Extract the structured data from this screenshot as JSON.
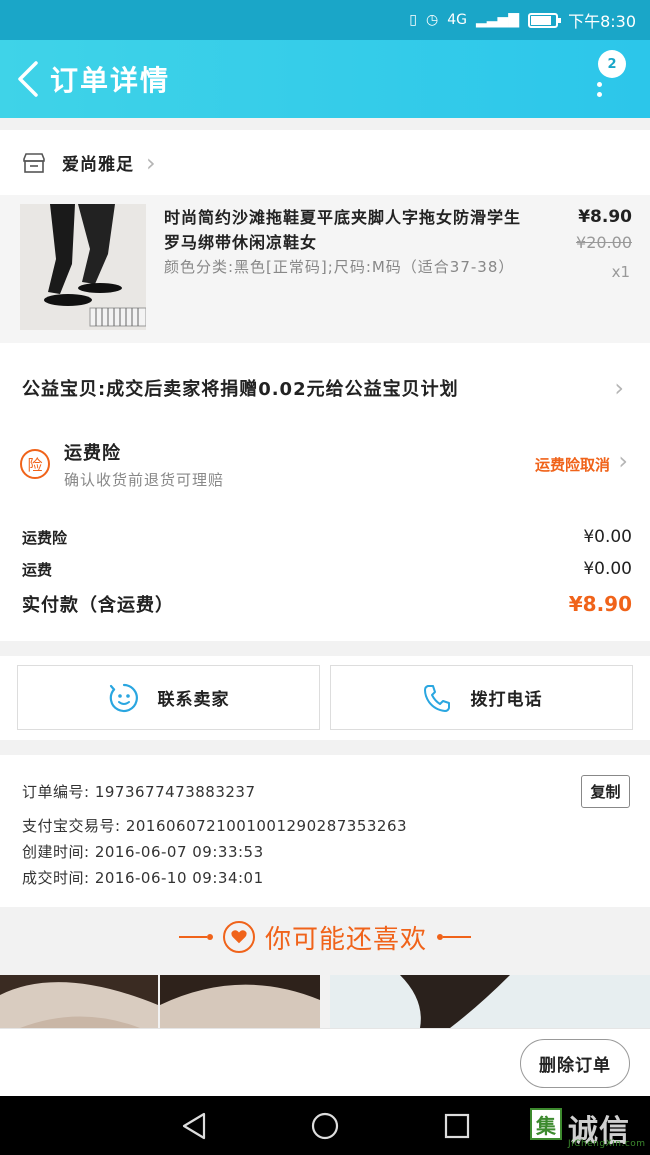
{
  "status_bar": {
    "signal": "4G",
    "time": "下午8:30",
    "battery_level": 0.85
  },
  "header": {
    "title": "订单详情",
    "badge_count": "2"
  },
  "shop": {
    "name": "爱尚雅足"
  },
  "product": {
    "title": "时尚简约沙滩拖鞋夏平底夹脚人字拖女防滑学生罗马绑带休闲凉鞋女",
    "spec": "颜色分类:黑色[正常码];尺码:M码（适合37-38）",
    "price": "¥8.90",
    "original_price": "¥20.00",
    "quantity": "x1"
  },
  "charity": {
    "text": "公益宝贝:成交后卖家将捐赠0.02元给公益宝贝计划"
  },
  "insurance": {
    "icon_char": "险",
    "title": "运费险",
    "subtitle": "确认收货前退货可理赔",
    "action": "运费险取消"
  },
  "fees": [
    {
      "label": "运费险",
      "value": "¥0.00"
    },
    {
      "label": "运费",
      "value": "¥0.00"
    }
  ],
  "total": {
    "label": "实付款（含运费）",
    "value": "¥8.90"
  },
  "actions": {
    "contact_seller": "联系卖家",
    "call_phone": "拨打电话"
  },
  "order_info": {
    "order_no": "订单编号: 1973677473883237",
    "alipay_no": "支付宝交易号: 2016060721001001290287353263",
    "created": "创建时间: 2016-06-07 09:33:53",
    "completed": "成交时间: 2016-06-10 09:34:01",
    "copy": "复制"
  },
  "recommend": {
    "title": "你可能还喜欢"
  },
  "bottom": {
    "delete_order": "删除订单"
  },
  "watermark": {
    "logo": "集",
    "text": "诚信",
    "sub": "JiChengXin.com"
  },
  "colors": {
    "header": "#2cc6ea",
    "accent": "#f0631a"
  }
}
